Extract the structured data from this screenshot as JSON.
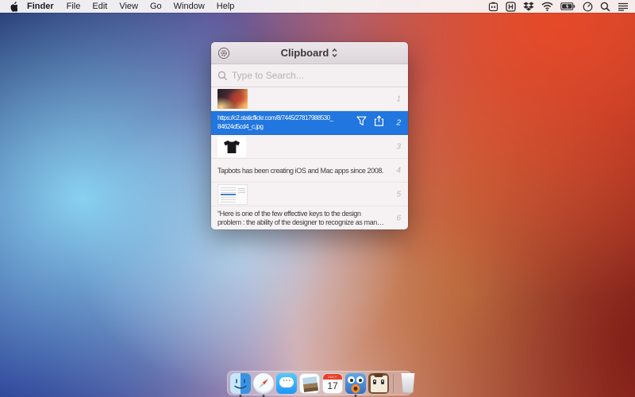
{
  "menu_bar": {
    "active_app": "Finder",
    "items": [
      "Finder",
      "File",
      "Edit",
      "View",
      "Go",
      "Window",
      "Help"
    ],
    "status_icons": [
      "pastebot",
      "h-app",
      "dropbox",
      "wifi",
      "battery-charging",
      "clock",
      "spotlight",
      "notification-center"
    ]
  },
  "window": {
    "title": "Clipboard",
    "search_placeholder": "Type to Search...",
    "rows": [
      {
        "index": "1",
        "type": "image",
        "content": "sunset car photo thumbnail"
      },
      {
        "index": "2",
        "type": "url",
        "selected": true,
        "line1": "https://c2.staticflickr.com/8/7445/27817988530_",
        "line2": "84624d5cd4_c.jpg"
      },
      {
        "index": "3",
        "type": "image",
        "content": "black t-shirt photo thumbnail"
      },
      {
        "index": "4",
        "type": "text",
        "text": "Tapbots has been creating iOS and Mac apps since 2008."
      },
      {
        "index": "5",
        "type": "image",
        "content": "app window screenshot thumbnail"
      },
      {
        "index": "6",
        "type": "text",
        "text": "“Here is one of the few effective keys to the design problem : the ability of the designer to recognize as many of the co..."
      }
    ]
  },
  "dock": {
    "items": [
      "Finder",
      "Safari",
      "Messages",
      "Photos",
      "Calendar",
      "Tweetbot",
      "Pastebot",
      "Trash"
    ],
    "running": [
      "Finder",
      "Safari",
      "Tweetbot"
    ],
    "calendar": {
      "month": "JULY",
      "day": "17"
    }
  },
  "colors": {
    "selection_blue": "#2176DF",
    "menu_bar_bg": "#F8F5F6",
    "calendar_red": "#E8402A"
  }
}
